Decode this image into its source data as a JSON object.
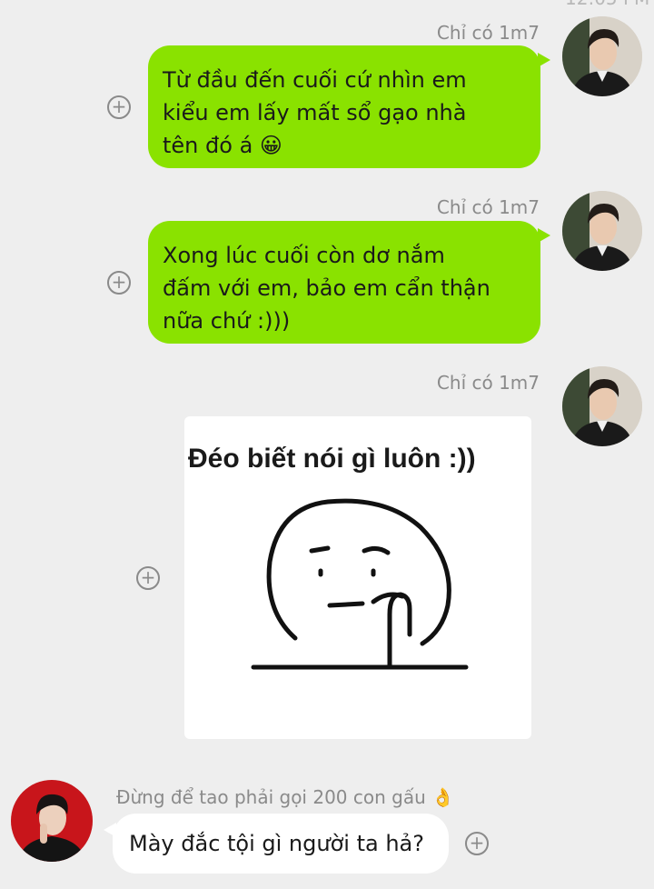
{
  "top_fragment": "12:05 PM",
  "messages": [
    {
      "sender": "Chỉ có 1m7",
      "lines": [
        "Từ đầu đến cuối cứ nhìn em",
        "kiểu em lấy mất sổ gạo nhà",
        "tên đó á 😀"
      ]
    },
    {
      "sender": "Chỉ có 1m7",
      "lines": [
        "Xong lúc cuối còn dơ nắm",
        "đấm với em, bảo em cẩn thận",
        "nữa chứ :)))"
      ]
    },
    {
      "sender": "Chỉ có 1m7",
      "sticker_text": "Đéo biết nói gì luôn :))"
    },
    {
      "sender": "Đừng để tao phải gọi 200 con gấu 👌",
      "text": "Mày đắc tội gì người ta hả?"
    }
  ],
  "icons": {
    "add": "plus-circle-icon",
    "avatar": "avatar"
  },
  "colors": {
    "background": "#eeeeee",
    "outgoing_bubble": "#8ae200",
    "incoming_bubble": "#ffffff",
    "meta_text": "#8a8a8a"
  }
}
